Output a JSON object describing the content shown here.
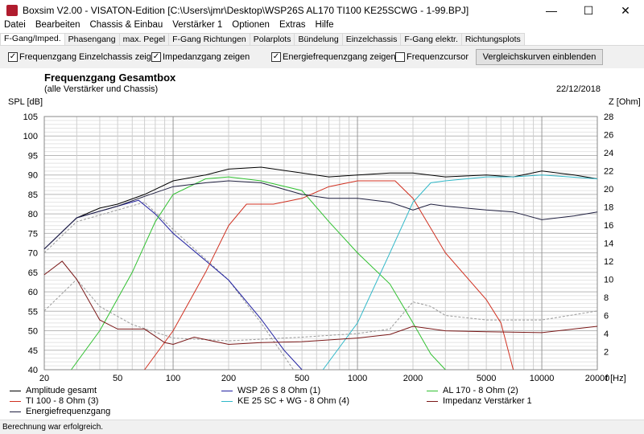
{
  "window": {
    "title": "Boxsim V2.00 - VISATON-Edition [C:\\Users\\jmr\\Desktop\\WSP26S AL170 TI100 KE25SCWG - 1-99.BPJ]",
    "minimize": "—",
    "maximize": "☐",
    "close": "✕"
  },
  "menu": [
    "Datei",
    "Bearbeiten",
    "Chassis & Einbau",
    "Verstärker 1",
    "Optionen",
    "Extras",
    "Hilfe"
  ],
  "tabs": [
    "F-Gang/Imped.",
    "Phasengang",
    "max. Pegel",
    "F-Gang Richtungen",
    "Polarplots",
    "Bündelung",
    "Einzelchassis",
    "F-Gang elektr.",
    "Richtungsplots"
  ],
  "options": [
    {
      "label": "Frequenzgang Einzelchassis zeigen",
      "checked": true
    },
    {
      "label": "Impedanzgang zeigen",
      "checked": true
    },
    {
      "label": "Energiefrequenzgang zeigen",
      "checked": true
    },
    {
      "label": "Frequenzcursor",
      "checked": false
    }
  ],
  "compare_button": "Vergleichskurven einblenden",
  "status": "Berechnung war erfolgreich.",
  "chart_data": {
    "type": "line",
    "title": "Frequenzgang Gesamtbox",
    "subtitle": "(alle Verstärker und Chassis)",
    "date": "22/12/2018",
    "ylabel": "SPL [dB]",
    "y2label": "Z [Ohm]",
    "xlabel": "f [Hz]",
    "xlim": [
      20,
      20000
    ],
    "ylim": [
      40,
      105
    ],
    "y2lim": [
      0,
      28
    ],
    "xscale": "log",
    "xticks": [
      20,
      50,
      100,
      200,
      500,
      1000,
      2000,
      5000,
      10000,
      20000
    ],
    "yticks": [
      40,
      45,
      50,
      55,
      60,
      65,
      70,
      75,
      80,
      85,
      90,
      95,
      100,
      105
    ],
    "y2ticks": [
      2,
      4,
      6,
      8,
      10,
      12,
      14,
      16,
      18,
      20,
      22,
      24,
      26,
      28
    ],
    "series": [
      {
        "name": "Amplitude gesamt",
        "color": "#000000",
        "axis": "left",
        "points": [
          [
            20,
            71
          ],
          [
            30,
            79
          ],
          [
            40,
            81.5
          ],
          [
            50,
            82.5
          ],
          [
            70,
            85
          ],
          [
            100,
            88.5
          ],
          [
            150,
            90
          ],
          [
            200,
            91.5
          ],
          [
            300,
            92
          ],
          [
            500,
            90.5
          ],
          [
            700,
            89.5
          ],
          [
            1000,
            90
          ],
          [
            1500,
            90.5
          ],
          [
            2000,
            90.5
          ],
          [
            3000,
            89.5
          ],
          [
            5000,
            90
          ],
          [
            7000,
            89.5
          ],
          [
            10000,
            91
          ],
          [
            15000,
            90
          ],
          [
            20000,
            89
          ]
        ]
      },
      {
        "name": "WSP 26 S 8 Ohm (1)",
        "color": "#2020a0",
        "axis": "left",
        "points": [
          [
            20,
            71
          ],
          [
            30,
            79
          ],
          [
            50,
            82
          ],
          [
            65,
            83.5
          ],
          [
            80,
            80
          ],
          [
            100,
            75
          ],
          [
            150,
            68
          ],
          [
            200,
            63
          ],
          [
            300,
            53
          ],
          [
            400,
            45
          ],
          [
            500,
            40
          ]
        ]
      },
      {
        "name": "AL 170 - 8 Ohm (2)",
        "color": "#30c030",
        "axis": "left",
        "points": [
          [
            28,
            40
          ],
          [
            40,
            50
          ],
          [
            60,
            65
          ],
          [
            80,
            78
          ],
          [
            100,
            85
          ],
          [
            150,
            89
          ],
          [
            200,
            89.5
          ],
          [
            300,
            88.5
          ],
          [
            500,
            86
          ],
          [
            700,
            78
          ],
          [
            1000,
            70
          ],
          [
            1500,
            62
          ],
          [
            2000,
            52
          ],
          [
            2500,
            44
          ],
          [
            3000,
            40
          ]
        ]
      },
      {
        "name": "TI 100 - 8 Ohm (3)",
        "color": "#d03020",
        "axis": "left",
        "points": [
          [
            70,
            40
          ],
          [
            100,
            50
          ],
          [
            150,
            65
          ],
          [
            200,
            77
          ],
          [
            250,
            82.5
          ],
          [
            350,
            82.5
          ],
          [
            500,
            84
          ],
          [
            700,
            87
          ],
          [
            1000,
            88.5
          ],
          [
            1600,
            88.5
          ],
          [
            2000,
            84
          ],
          [
            3000,
            70
          ],
          [
            5000,
            58
          ],
          [
            6000,
            52
          ],
          [
            7000,
            40
          ]
        ]
      },
      {
        "name": "KE 25 SC + WG - 8 Ohm (4)",
        "color": "#30b8c8",
        "axis": "left",
        "points": [
          [
            650,
            40
          ],
          [
            1000,
            52
          ],
          [
            1500,
            70
          ],
          [
            2000,
            83
          ],
          [
            2500,
            88
          ],
          [
            3000,
            88.5
          ],
          [
            5000,
            89.5
          ],
          [
            7000,
            89.5
          ],
          [
            10000,
            90
          ],
          [
            20000,
            89
          ]
        ]
      },
      {
        "name": "Impedanz Verstärker 1",
        "color": "#7a1818",
        "axis": "right",
        "points": [
          [
            20,
            10.5
          ],
          [
            25,
            12
          ],
          [
            30,
            10
          ],
          [
            40,
            5.5
          ],
          [
            50,
            4.5
          ],
          [
            70,
            4.5
          ],
          [
            90,
            3
          ],
          [
            100,
            2.8
          ],
          [
            130,
            3.6
          ],
          [
            200,
            2.8
          ],
          [
            300,
            3
          ],
          [
            500,
            3.1
          ],
          [
            1000,
            3.5
          ],
          [
            1500,
            3.9
          ],
          [
            2000,
            4.8
          ],
          [
            3000,
            4.3
          ],
          [
            5000,
            4.2
          ],
          [
            10000,
            4.1
          ],
          [
            20000,
            4.8
          ]
        ]
      },
      {
        "name": "Energiefrequenzgang",
        "color": "#202040",
        "axis": "left",
        "points": [
          [
            20,
            71
          ],
          [
            30,
            79
          ],
          [
            50,
            82
          ],
          [
            70,
            84.5
          ],
          [
            100,
            87
          ],
          [
            150,
            88
          ],
          [
            200,
            88.5
          ],
          [
            300,
            88
          ],
          [
            500,
            85
          ],
          [
            700,
            84
          ],
          [
            1000,
            84
          ],
          [
            1500,
            83
          ],
          [
            2000,
            81
          ],
          [
            2500,
            82.5
          ],
          [
            3000,
            82
          ],
          [
            5000,
            81
          ],
          [
            7000,
            80.5
          ],
          [
            10000,
            78.5
          ],
          [
            15000,
            79.5
          ],
          [
            20000,
            80.5
          ]
        ]
      }
    ],
    "reference_dashed": [
      {
        "color": "#999999",
        "axis": "right",
        "points": [
          [
            20,
            6.5
          ],
          [
            30,
            10
          ],
          [
            40,
            7
          ],
          [
            60,
            5
          ],
          [
            100,
            3.5
          ],
          [
            200,
            3.2
          ],
          [
            500,
            3.6
          ],
          [
            1000,
            4
          ],
          [
            1500,
            4.5
          ],
          [
            2000,
            7.5
          ],
          [
            2500,
            7
          ],
          [
            3000,
            6
          ],
          [
            5000,
            5.5
          ],
          [
            10000,
            5.5
          ],
          [
            20000,
            6.5
          ]
        ]
      },
      {
        "color": "#999999",
        "axis": "left",
        "points": [
          [
            20,
            70
          ],
          [
            30,
            78
          ],
          [
            50,
            81
          ],
          [
            70,
            83
          ],
          [
            100,
            76
          ],
          [
            200,
            63
          ],
          [
            300,
            52
          ],
          [
            450,
            40
          ]
        ]
      }
    ]
  }
}
